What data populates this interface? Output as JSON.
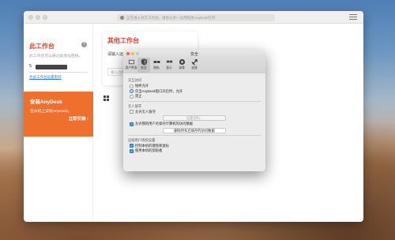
{
  "browser": {
    "url": "正在进入对方工作台，请求从另一应用程序AnyDesk打开"
  },
  "left_panel": {
    "title": "此工作台",
    "help": "?",
    "description": "此工作台可以通过此地址连接。",
    "id_prefix": "5"
  },
  "left_link": "为此工作台设置密码",
  "promo": {
    "title": "安装AnyDesk",
    "description": "在本机上安装AnyDesk。",
    "link": "立即安装 ›"
  },
  "other_desk": {
    "title": "其他工作台",
    "label": "请输入远",
    "input_placeholder": "输入远程"
  },
  "dialog": {
    "title": "安全",
    "tabs": [
      {
        "label": "用户界面",
        "icon": "user-interface-icon"
      },
      {
        "label": "安全",
        "icon": "security-icon",
        "selected": true
      },
      {
        "label": "隐私",
        "icon": "privacy-icon"
      },
      {
        "label": "显示",
        "icon": "display-icon"
      },
      {
        "label": "录像",
        "icon": "recording-icon"
      },
      {
        "label": "连接",
        "icon": "connection-icon"
      }
    ],
    "section_interactive": "交互访问",
    "interactive_options": [
      {
        "label": "始终允许",
        "checked": false
      },
      {
        "label": "仅当AnyDesk窗口开启时，允许",
        "checked": true
      },
      {
        "label": "禁止",
        "checked": false
      }
    ],
    "section_unattended": "无人值守",
    "unattended_option": "允许无人值守",
    "set_password_button": "设置密码...",
    "remember_option": "允许我的用户名保存计算机的访问数据",
    "clear_button": "删除所有已保存的访问数据",
    "section_permissions": "远程用户授权设置",
    "permission_options": [
      {
        "label": "控制本机的键盘和鼠标",
        "checked": true
      },
      {
        "label": "使用本机的剪贴板",
        "checked": true
      }
    ]
  }
}
